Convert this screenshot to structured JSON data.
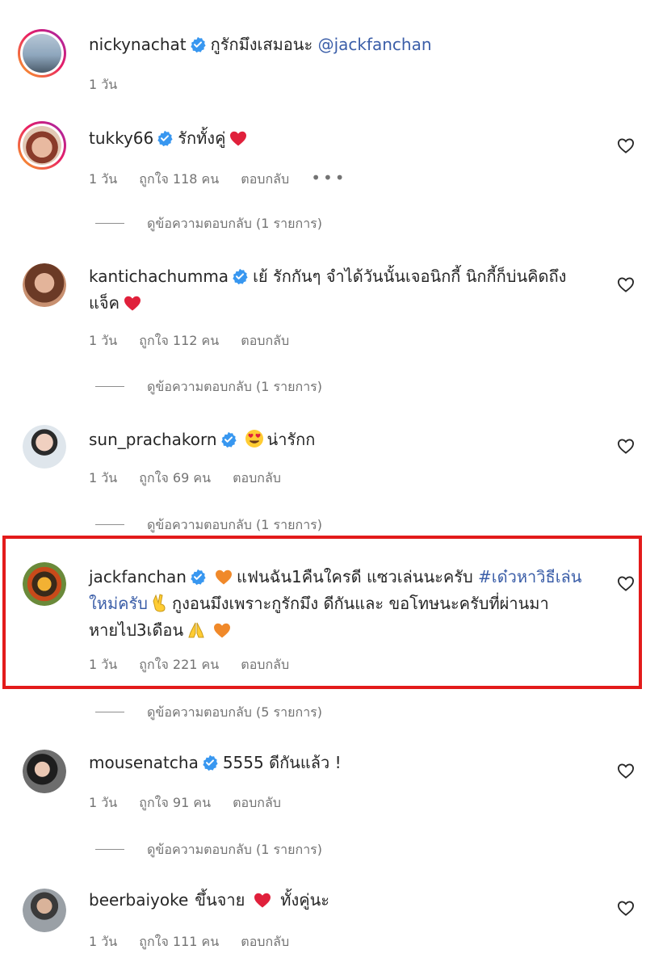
{
  "colors": {
    "verified": "#3897f0",
    "heart_red": "#e0203b",
    "heart_orange": "#f0892a",
    "highlight": "#e31b1b",
    "hashtag": "#3b5ea8"
  },
  "comments": [
    {
      "user": "nickynachat",
      "text": "กูรักมึงเสมอนะ",
      "mention": "@jackfanchan",
      "time": "1 วัน"
    },
    {
      "user": "tukky66",
      "text": "รักทั้งคู่",
      "time": "1 วัน",
      "likes": "ถูกใจ 118 คน",
      "reply": "ตอบกลับ",
      "more": "•••",
      "replies": "ดูข้อความตอบกลับ (1 รายการ)"
    },
    {
      "user": "kantichachumma",
      "text": "เย้ รักกันๆ จำได้วันนั้นเจอนิกกี้ นิกกี้ก็บ่นคิดถึง",
      "text2": "แจ็ค",
      "time": "1 วัน",
      "likes": "ถูกใจ 112 คน",
      "reply": "ตอบกลับ",
      "replies": "ดูข้อความตอบกลับ (1 รายการ)"
    },
    {
      "user": "sun_prachakorn",
      "text": "น่ารักก",
      "time": "1 วัน",
      "likes": "ถูกใจ 69 คน",
      "reply": "ตอบกลับ",
      "replies": "ดูข้อความตอบกลับ (1 รายการ)"
    },
    {
      "user": "jackfanchan",
      "text": "แฟนฉัน1คืนใครดี แซวเล่นนะครับ",
      "hashtag_a": "#เด๋วหาวิธีเล่น",
      "hashtag_b": "ใหม่ครับ",
      "text2": "กูงอนมึงเพราะกูรักมึง ดีกันและ ขอโทษนะครับที่ผ่านมา",
      "text3": "หายไป3เดือน",
      "time": "1 วัน",
      "likes": "ถูกใจ 221 คน",
      "reply": "ตอบกลับ",
      "replies": "ดูข้อความตอบกลับ (5 รายการ)"
    },
    {
      "user": "mousenatcha",
      "text": "5555 ดีกันแล้ว !",
      "time": "1 วัน",
      "likes": "ถูกใจ 91 คน",
      "reply": "ตอบกลับ",
      "replies": "ดูข้อความตอบกลับ (1 รายการ)"
    },
    {
      "user": "beerbaiyoke",
      "text": "ขึ้นจาย",
      "text2": "ทั้งคู่นะ",
      "time": "1 วัน",
      "likes": "ถูกใจ 111 คน",
      "reply": "ตอบกลับ"
    }
  ]
}
